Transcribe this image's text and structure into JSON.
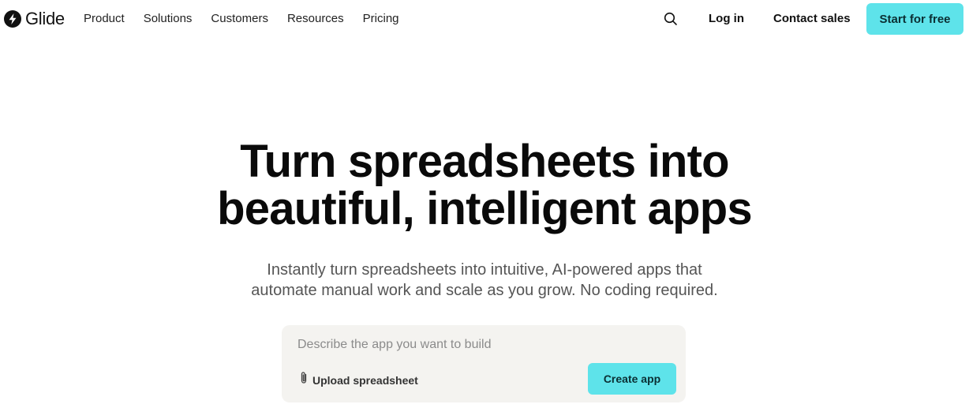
{
  "brand": {
    "name": "Glide"
  },
  "nav": {
    "links": [
      "Product",
      "Solutions",
      "Customers",
      "Resources",
      "Pricing"
    ],
    "login": "Log in",
    "contact": "Contact sales",
    "cta": "Start for free"
  },
  "hero": {
    "title_line1": "Turn spreadsheets into",
    "title_line2": "beautiful, intelligent apps",
    "subtitle_line1": "Instantly turn spreadsheets into intuitive, AI-powered apps that",
    "subtitle_line2": "automate manual work and scale as you grow. No coding required."
  },
  "prompt": {
    "placeholder": "Describe the app you want to build",
    "upload_label": "Upload spreadsheet",
    "create_label": "Create app"
  },
  "colors": {
    "accent": "#5ee3ea",
    "prompt_bg": "#f4f3f0"
  }
}
